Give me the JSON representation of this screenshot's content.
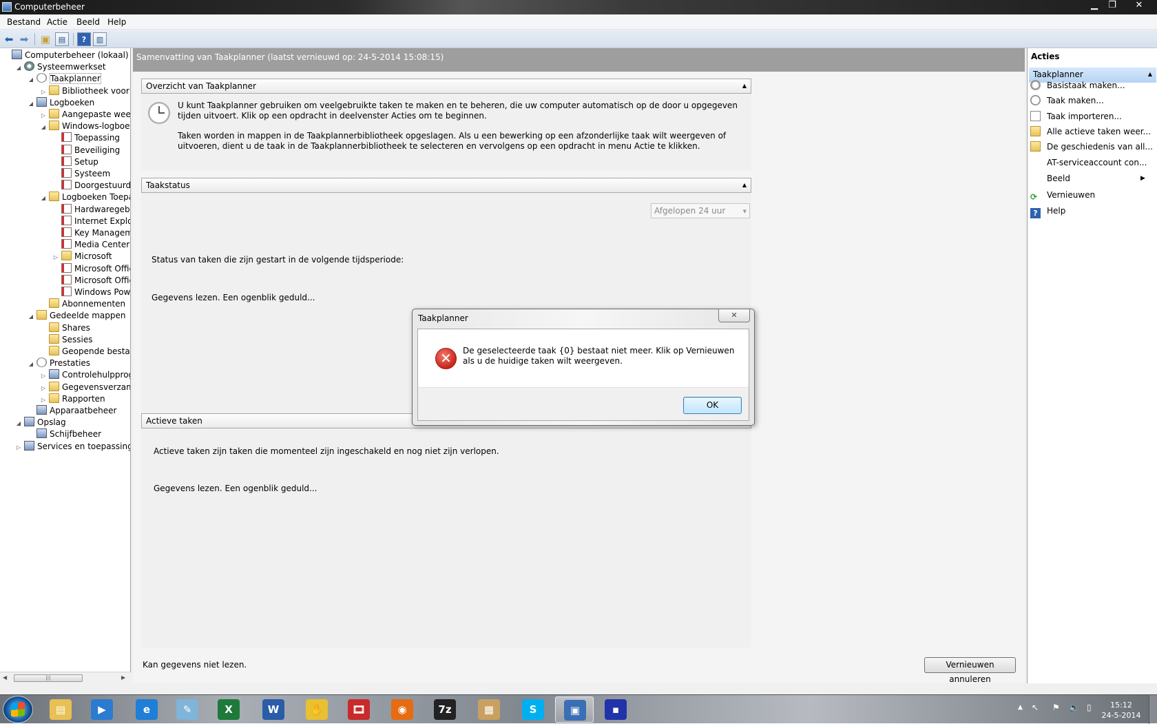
{
  "window": {
    "title": "Computerbeheer",
    "min": "▁",
    "max": "❐",
    "close": "✕"
  },
  "menu": [
    "Bestand",
    "Actie",
    "Beeld",
    "Help"
  ],
  "tree": [
    {
      "label": "Computerbeheer (lokaal)",
      "icon": "computer-management-icon"
    },
    {
      "label": "Systeemwerkset",
      "icon": "tools-icon"
    },
    {
      "label": "Taakplanner",
      "icon": "clock-icon"
    },
    {
      "label": "Bibliotheek voor Taa",
      "icon": "folder-icon"
    },
    {
      "label": "Logboeken",
      "icon": "event-viewer-icon"
    },
    {
      "label": "Aangepaste weergav",
      "icon": "folder-icon"
    },
    {
      "label": "Windows-logboeken",
      "icon": "folder-icon"
    },
    {
      "label": "Toepassing",
      "icon": "log-icon"
    },
    {
      "label": "Beveiliging",
      "icon": "log-icon"
    },
    {
      "label": "Setup",
      "icon": "log-icon"
    },
    {
      "label": "Systeem",
      "icon": "log-icon"
    },
    {
      "label": "Doorgestuurde g",
      "icon": "log-icon"
    },
    {
      "label": "Logboeken Toepass",
      "icon": "folder-icon"
    },
    {
      "label": "Hardwaregebeur",
      "icon": "log-icon"
    },
    {
      "label": "Internet Explorer",
      "icon": "log-icon"
    },
    {
      "label": "Key Managemer",
      "icon": "log-icon"
    },
    {
      "label": "Media Center",
      "icon": "log-icon"
    },
    {
      "label": "Microsoft",
      "icon": "folder-icon"
    },
    {
      "label": "Microsoft Office",
      "icon": "log-icon"
    },
    {
      "label": "Microsoft Office",
      "icon": "log-icon"
    },
    {
      "label": "Windows Power",
      "icon": "log-icon"
    },
    {
      "label": "Abonnementen",
      "icon": "subscriptions-icon"
    },
    {
      "label": "Gedeelde mappen",
      "icon": "shared-folders-icon"
    },
    {
      "label": "Shares",
      "icon": "shares-icon"
    },
    {
      "label": "Sessies",
      "icon": "sessions-icon"
    },
    {
      "label": "Geopende bestande",
      "icon": "open-files-icon"
    },
    {
      "label": "Prestaties",
      "icon": "performance-icon"
    },
    {
      "label": "Controlehulpprogra",
      "icon": "monitor-icon"
    },
    {
      "label": "Gegevensverzamela",
      "icon": "data-collector-icon"
    },
    {
      "label": "Rapporten",
      "icon": "reports-icon"
    },
    {
      "label": "Apparaatbeheer",
      "icon": "device-manager-icon"
    },
    {
      "label": "Opslag",
      "icon": "storage-icon"
    },
    {
      "label": "Schijfbeheer",
      "icon": "disk-management-icon"
    },
    {
      "label": "Services en toepassingen",
      "icon": "services-icon"
    }
  ],
  "center": {
    "summary": "Samenvatting van Taakplanner (laatst vernieuwd op: 24-5-2014 15:08:15)",
    "overview_title": "Overzicht van Taakplanner",
    "overview_p1": "U kunt Taakplanner gebruiken om veelgebruikte taken te maken en te beheren, die uw computer automatisch op de door u opgegeven tijden uitvoert. Klik op een opdracht in deelvenster Acties om te beginnen.",
    "overview_p2": "Taken worden in mappen in de Taakplannerbibliotheek opgeslagen. Als u een bewerking op een afzonderlijke taak wilt weergeven of uitvoeren, dient u de taak in de Taakplannerbibliotheek te selecteren en vervolgens op een opdracht in menu Actie te klikken.",
    "status_title": "Taakstatus",
    "status_label": "Status van taken die zijn gestart in de volgende tijdsperiode:",
    "status_select": "Afgelopen 24 uur",
    "status_loading": "Gegevens lezen. Een ogenblik geduld...",
    "active_title": "Actieve taken",
    "active_desc": "Actieve taken zijn taken die momenteel zijn ingeschakeld en nog niet zijn verlopen.",
    "active_loading": "Gegevens lezen. Een ogenblik geduld...",
    "footer_status": "Kan gegevens niet lezen.",
    "cancel_refresh": "Vernieuwen annuleren"
  },
  "actions": {
    "header": "Acties",
    "section": "Taakplanner",
    "items": [
      {
        "label": "Basistaak maken...",
        "icon": "basic-task-icon"
      },
      {
        "label": "Taak maken...",
        "icon": "create-task-icon"
      },
      {
        "label": "Taak importeren...",
        "icon": "import-task-icon"
      },
      {
        "label": "Alle actieve taken weer...",
        "icon": "folder-icon"
      },
      {
        "label": "De geschiedenis van all...",
        "icon": "folder-icon"
      },
      {
        "label": "AT-serviceaccount con...",
        "icon": ""
      },
      {
        "label": "Beeld",
        "icon": ""
      },
      {
        "label": "Vernieuwen",
        "icon": "refresh-icon"
      },
      {
        "label": "Help",
        "icon": "help-icon"
      }
    ]
  },
  "dialog": {
    "title": "Taakplanner",
    "close": "✕",
    "message": "De geselecteerde taak {0} bestaat niet meer. Klik op Vernieuwen als u de huidige taken wilt weergeven.",
    "ok": "OK"
  },
  "taskbar": {
    "apps": [
      "explorer-icon",
      "media-player-icon",
      "internet-explorer-icon",
      "notepad-icon",
      "excel-icon",
      "word-icon",
      "paint-icon",
      "video-icon",
      "firefox-icon",
      "7zip-icon",
      "archive-icon",
      "skype-icon",
      "computer-management-icon",
      "save-icon"
    ],
    "clock_time": "15:12",
    "clock_date": "24-5-2014",
    "tray_up": "▲"
  },
  "colors": {
    "accent": "#3399ff",
    "error": "#c7261a",
    "summary_bar": "#9e9e9e"
  }
}
